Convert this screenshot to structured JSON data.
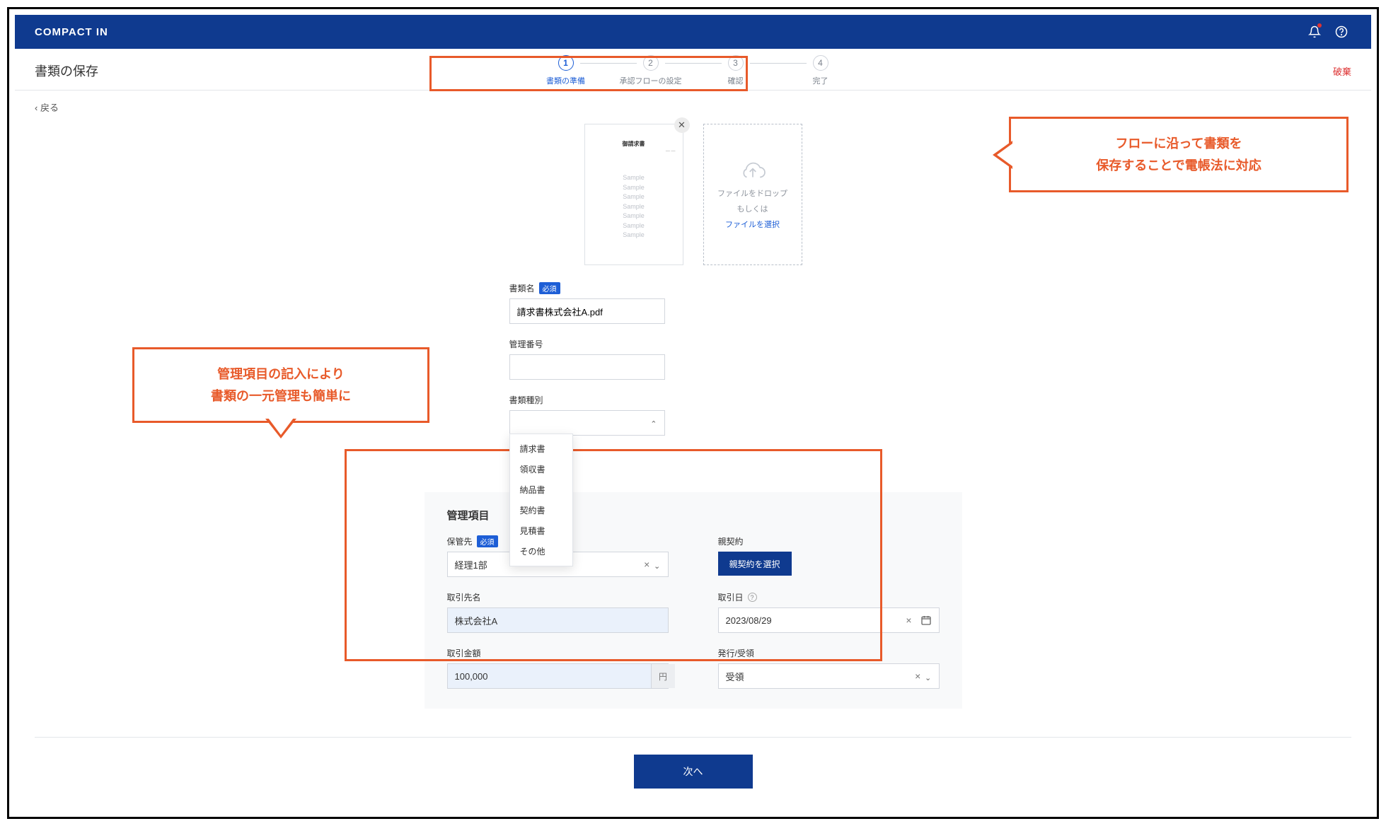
{
  "header": {
    "logo": "COMPACT IN"
  },
  "page": {
    "title": "書類の保存",
    "discard": "破棄",
    "back": "‹ 戻る"
  },
  "steps": [
    {
      "num": "1",
      "label": "書類の準備",
      "active": true
    },
    {
      "num": "2",
      "label": "承認フローの設定",
      "active": false
    },
    {
      "num": "3",
      "label": "確認",
      "active": false
    },
    {
      "num": "4",
      "label": "完了",
      "active": false
    }
  ],
  "preview": {
    "doc_title": "御請求書",
    "samples": [
      "Sample",
      "Sample",
      "Sample",
      "Sample",
      "Sample",
      "Sample",
      "Sample"
    ]
  },
  "dropzone": {
    "line1": "ファイルをドロップ",
    "line2": "もしくは",
    "link": "ファイルを選択"
  },
  "form": {
    "doc_name_label": "書類名",
    "required_badge": "必須",
    "doc_name_value": "請求書株式会社A.pdf",
    "mgmt_no_label": "管理番号",
    "mgmt_no_value": "",
    "doc_type_label": "書類種別",
    "doc_type_value": "",
    "doc_type_options": [
      "請求書",
      "領収書",
      "納品書",
      "契約書",
      "見積書",
      "その他"
    ]
  },
  "mgmt": {
    "section_title": "管理項目",
    "storage_label": "保管先",
    "storage_value": "経理1部",
    "parent_label": "親契約",
    "parent_btn": "親契約を選択",
    "partner_label": "取引先名",
    "partner_value": "株式会社A",
    "date_label": "取引日",
    "date_value": "2023/08/29",
    "amount_label": "取引金額",
    "amount_value": "100,000",
    "amount_unit": "円",
    "issue_label": "発行/受領",
    "issue_value": "受領"
  },
  "footer": {
    "next": "次へ"
  },
  "callouts": {
    "right": "フローに沿って書類を\n保存することで電帳法に対応",
    "left_line1": "管理項目の記入により",
    "left_line2": "書類の一元管理も簡単に"
  }
}
